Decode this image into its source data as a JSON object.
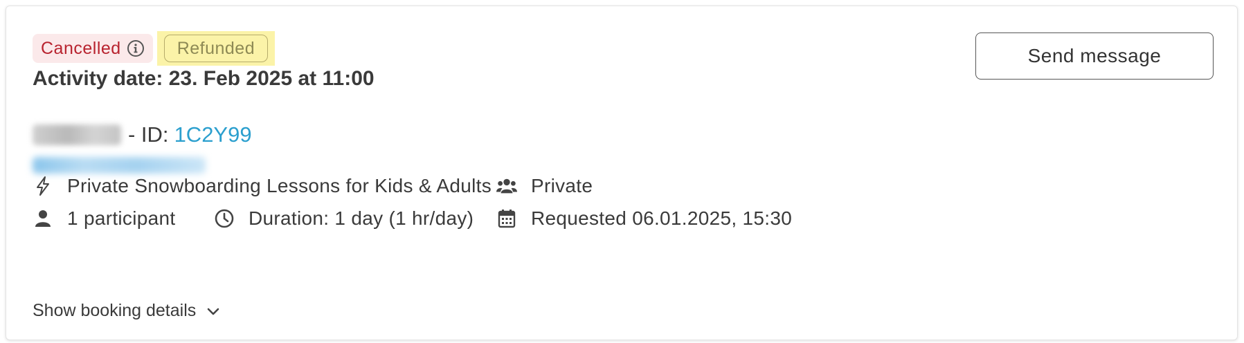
{
  "status": {
    "cancelled_label": "Cancelled",
    "refunded_label": "Refunded"
  },
  "actions": {
    "send_message_label": "Send message"
  },
  "booking": {
    "activity_date": "Activity date: 23. Feb 2025 at 11:00",
    "id_prefix": "- ID:",
    "id_value": "1C2Y99"
  },
  "details": {
    "activity_name": "Private Snowboarding Lessons for Kids & Adults",
    "group_type": "Private",
    "participants": "1 participant",
    "duration": "Duration: 1 day (1 hr/day)",
    "requested": "Requested 06.01.2025, 15:30"
  },
  "footer": {
    "show_details_label": "Show booking details"
  },
  "colors": {
    "cancelled_text": "#b8232f",
    "cancelled_bg": "#fbe9ea",
    "highlight_bg": "#fbf3a8",
    "link": "#2b9fce"
  }
}
